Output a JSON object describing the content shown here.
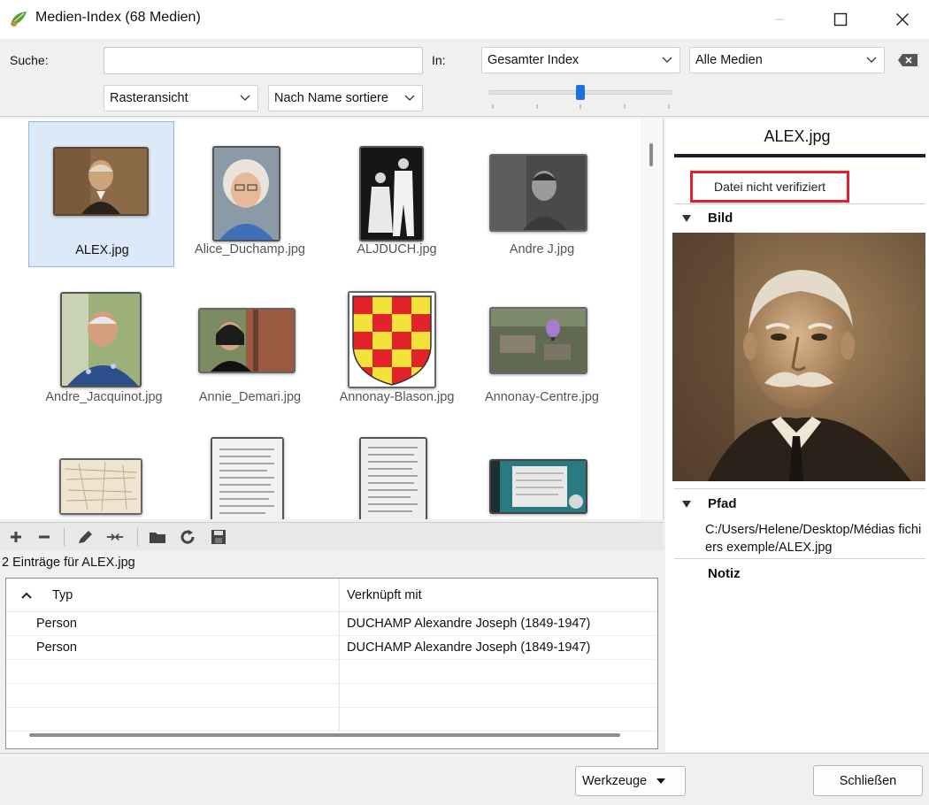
{
  "window": {
    "title": "Medien-Index (68 Medien)"
  },
  "toolbar": {
    "search_label": "Suche:",
    "search_value": "",
    "in_label": "In:",
    "scope_value": "Gesamter Index",
    "filter_value": "Alle Medien",
    "view_value": "Rasteransicht",
    "sort_value": "Nach Name sortiere",
    "zoom_fraction": 0.5
  },
  "grid": {
    "items": [
      {
        "label": "ALEX.jpg",
        "selected": true
      },
      {
        "label": "Alice_Duchamp.jpg"
      },
      {
        "label": "ALJDUCH.jpg"
      },
      {
        "label": "Andre J.jpg"
      },
      {
        "label": "Andre_Jacquinot.jpg"
      },
      {
        "label": "Annie_Demari.jpg"
      },
      {
        "label": "Annonay-Blason.jpg"
      },
      {
        "label": "Annonay-Centre.jpg"
      }
    ]
  },
  "entries": {
    "count_label": "2 Einträge für ALEX.jpg",
    "columns": [
      "Typ",
      "Verknüpft mit"
    ],
    "rows": [
      {
        "type": "Person",
        "linked": "DUCHAMP Alexandre Joseph (1849-1947)"
      },
      {
        "type": "Person",
        "linked": "DUCHAMP Alexandre Joseph (1849-1947)"
      }
    ]
  },
  "details": {
    "file_name": "ALEX.jpg",
    "verify_status": "Datei nicht verifiziert",
    "image_section": "Bild",
    "path_section": "Pfad",
    "path_value": "C:/Users/Helene/Desktop/Médias fichiers exemple/ALEX.jpg",
    "note_section": "Notiz"
  },
  "footer": {
    "tools_label": "Werkzeuge",
    "close_label": "Schließen"
  },
  "colors": {
    "selection_bg": "#dbe9f8",
    "slider_accent": "#1a72d6",
    "verify_border": "#e0202a"
  }
}
